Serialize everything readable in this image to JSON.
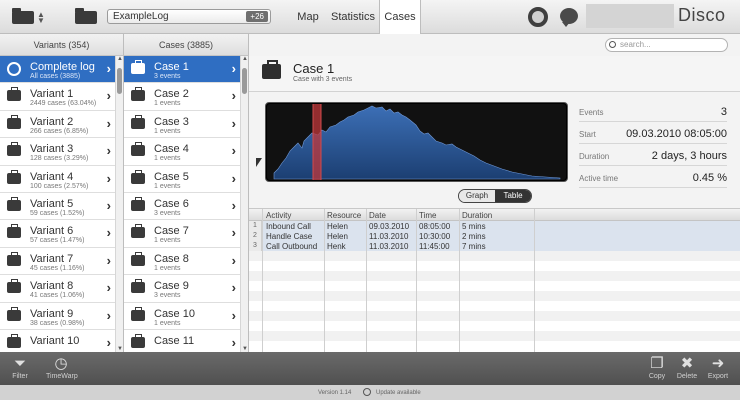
{
  "header": {
    "log_name": "ExampleLog",
    "log_badge": "+26",
    "tabs": [
      {
        "label": "Map",
        "active": false
      },
      {
        "label": "Statistics",
        "active": false
      },
      {
        "label": "Cases",
        "active": true
      }
    ],
    "brand": "Disco"
  },
  "variants": {
    "title": "Variants (354)",
    "items": [
      {
        "label": "Complete log",
        "sub": "All cases (3885)",
        "selected": true,
        "icon": "globe-icon"
      },
      {
        "label": "Variant 1",
        "sub": "2449 cases (63.04%)"
      },
      {
        "label": "Variant 2",
        "sub": "266 cases (6.85%)"
      },
      {
        "label": "Variant 3",
        "sub": "128 cases (3.29%)"
      },
      {
        "label": "Variant 4",
        "sub": "100 cases (2.57%)"
      },
      {
        "label": "Variant 5",
        "sub": "59 cases (1.52%)"
      },
      {
        "label": "Variant 6",
        "sub": "57 cases (1.47%)"
      },
      {
        "label": "Variant 7",
        "sub": "45 cases (1.16%)"
      },
      {
        "label": "Variant 8",
        "sub": "41 cases (1.06%)"
      },
      {
        "label": "Variant 9",
        "sub": "38 cases (0.98%)"
      },
      {
        "label": "Variant 10",
        "sub": ""
      }
    ]
  },
  "cases": {
    "title": "Cases (3885)",
    "items": [
      {
        "label": "Case 1",
        "sub": "3 events",
        "selected": true
      },
      {
        "label": "Case 2",
        "sub": "1 events"
      },
      {
        "label": "Case 3",
        "sub": "1 events"
      },
      {
        "label": "Case 4",
        "sub": "1 events"
      },
      {
        "label": "Case 5",
        "sub": "1 events"
      },
      {
        "label": "Case 6",
        "sub": "3 events"
      },
      {
        "label": "Case 7",
        "sub": "1 events"
      },
      {
        "label": "Case 8",
        "sub": "1 events"
      },
      {
        "label": "Case 9",
        "sub": "3 events"
      },
      {
        "label": "Case 10",
        "sub": "1 events"
      },
      {
        "label": "Case 11",
        "sub": ""
      }
    ]
  },
  "search": {
    "placeholder": "search..."
  },
  "detail": {
    "title": "Case 1",
    "subtitle": "Case with 3 events",
    "stats": [
      {
        "label": "Events",
        "value": "3"
      },
      {
        "label": "Start",
        "value": "09.03.2010 08:05:00"
      },
      {
        "label": "Duration",
        "value": "2 days, 3 hours"
      },
      {
        "label": "Active time",
        "value": "0.45 %"
      }
    ],
    "toggle": {
      "graph": "Graph",
      "table": "Table",
      "active": "Table"
    },
    "table": {
      "columns": [
        "Activity",
        "Resource",
        "Date",
        "Time",
        "Duration"
      ],
      "rows": [
        [
          "Inbound Call",
          "Helen",
          "09.03.2010",
          "08:05:00",
          "5 mins"
        ],
        [
          "Handle Case",
          "Helen",
          "11.03.2010",
          "10:30:00",
          "2 mins"
        ],
        [
          "Call Outbound",
          "Henk",
          "11.03.2010",
          "11:45:00",
          "7 mins"
        ]
      ]
    }
  },
  "toolbar": {
    "filter": "Filter",
    "timewarp": "TimeWarp",
    "copy": "Copy",
    "delete": "Delete",
    "export": "Export"
  },
  "footer": {
    "version": "Version 1.14",
    "update": "Update available"
  },
  "colors": {
    "selection": "#2f6ec2",
    "timeline": "#2f5c9a",
    "highlight": "#c0373a"
  }
}
